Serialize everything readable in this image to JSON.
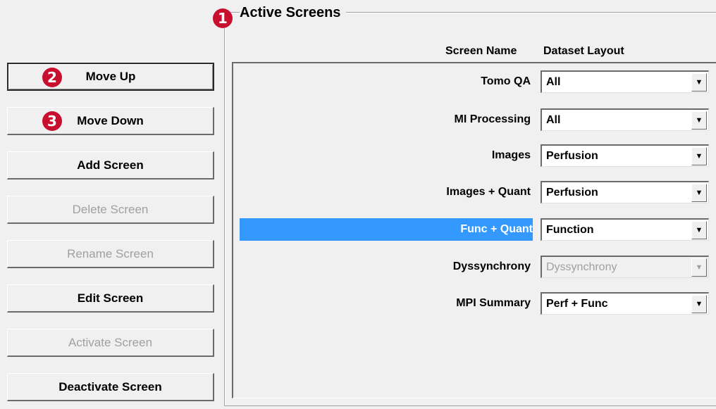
{
  "group": {
    "title": "Active Screens"
  },
  "markers": [
    "1",
    "2",
    "3"
  ],
  "columns": {
    "screen_name": "Screen Name",
    "dataset_layout": "Dataset Layout"
  },
  "buttons": [
    {
      "label": "Move Up",
      "enabled": true,
      "focused": true
    },
    {
      "label": "Move Down",
      "enabled": true
    },
    {
      "label": "Add Screen",
      "enabled": true
    },
    {
      "label": "Delete Screen",
      "enabled": false
    },
    {
      "label": "Rename Screen",
      "enabled": false
    },
    {
      "label": "Edit Screen",
      "enabled": true
    },
    {
      "label": "Activate Screen",
      "enabled": false
    },
    {
      "label": "Deactivate Screen",
      "enabled": true
    }
  ],
  "screens": [
    {
      "name": "Tomo QA",
      "layout": "All",
      "enabled": true
    },
    {
      "name": "MI Processing",
      "layout": "All",
      "enabled": true
    },
    {
      "name": "Images",
      "layout": "Perfusion",
      "enabled": true
    },
    {
      "name": "Images + Quant",
      "layout": "Perfusion",
      "enabled": true
    },
    {
      "name": "Func + Quant",
      "layout": "Function",
      "enabled": true,
      "selected": true
    },
    {
      "name": "Dyssynchrony",
      "layout": "Dyssynchrony",
      "enabled": false
    },
    {
      "name": "MPI Summary",
      "layout": "Perf + Func",
      "enabled": true
    }
  ],
  "icons": {
    "dropdown_arrow": "▼"
  },
  "colors": {
    "selection": "#3399ff",
    "marker": "#c8102e",
    "disabled_text": "#a0a0a0"
  }
}
